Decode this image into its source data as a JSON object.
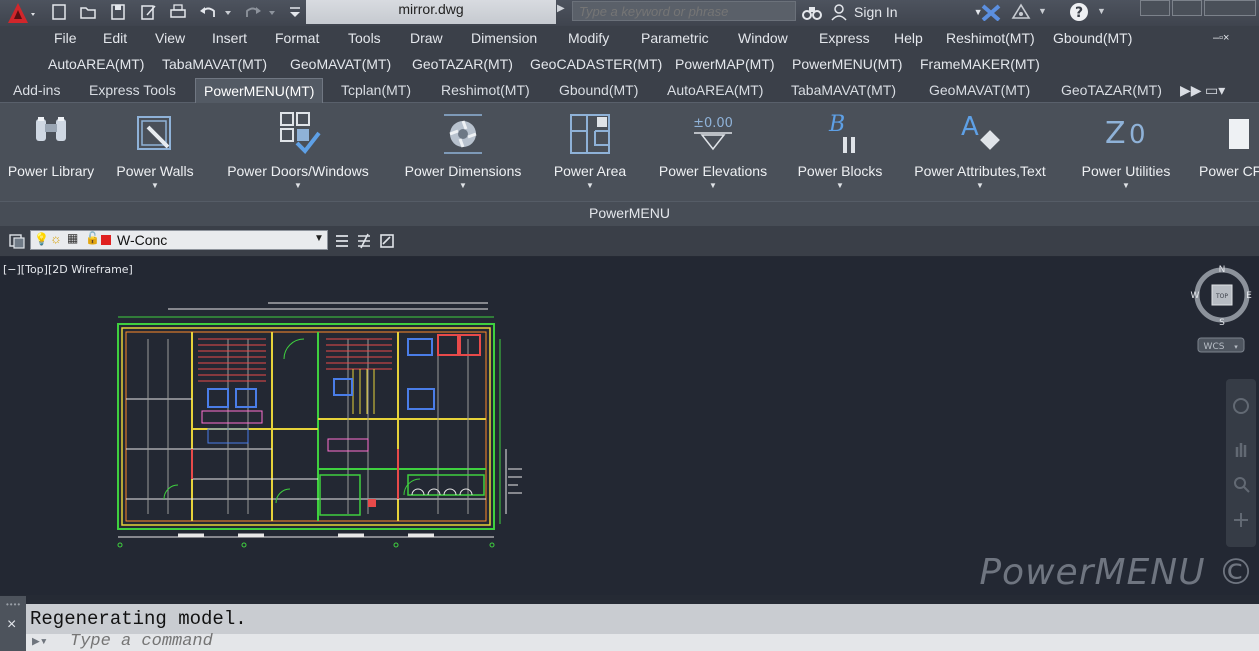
{
  "titlebar": {
    "file_name": "mirror.dwg",
    "search_placeholder": "Type a keyword or phrase",
    "sign_in": "Sign In"
  },
  "menubar1": [
    "File",
    "Edit",
    "View",
    "Insert",
    "Format",
    "Tools",
    "Draw",
    "Dimension",
    "Modify",
    "Parametric",
    "Window",
    "Express",
    "Help",
    "Reshimot(MT)",
    "Gbound(MT)"
  ],
  "menubar2": [
    "AutoAREA(MT)",
    "TabaMAVAT(MT)",
    "GeoMAVAT(MT)",
    "GeoTAZAR(MT)",
    "GeoCADASTER(MT)",
    "PowerMAP(MT)",
    "PowerMENU(MT)",
    "FrameMAKER(MT)"
  ],
  "ribbon_tabs": [
    "Add-ins",
    "Express Tools",
    "PowerMENU(MT)",
    "Tcplan(MT)",
    "Reshimot(MT)",
    "Gbound(MT)",
    "AutoAREA(MT)",
    "TabaMAVAT(MT)",
    "GeoMAVAT(MT)",
    "GeoTAZAR(MT)"
  ],
  "active_tab": "PowerMENU(MT)",
  "ribbon_tools": [
    {
      "label": "Power Library",
      "icon": "binoculars-icon"
    },
    {
      "label": "Power Walls",
      "icon": "walls-icon"
    },
    {
      "label": "Power Doors/Windows",
      "icon": "doors-windows-icon"
    },
    {
      "label": "Power Dimensions",
      "icon": "dimensions-icon"
    },
    {
      "label": "Power Area",
      "icon": "area-icon"
    },
    {
      "label": "Power Elevations",
      "icon": "elevations-icon"
    },
    {
      "label": "Power Blocks",
      "icon": "blocks-icon"
    },
    {
      "label": "Power Attributes,Text",
      "icon": "attributes-text-icon"
    },
    {
      "label": "Power Utilities",
      "icon": "utilities-icon"
    },
    {
      "label": "Power CF",
      "icon": "cf-icon"
    }
  ],
  "ribbon_panel_title": "PowerMENU",
  "elevation_glyph": "±0.00",
  "blocks_glyph": "B",
  "attr_glyph": "A",
  "util_glyph": "Z",
  "util_glyph2": "0",
  "layer": {
    "name": "W-Conc",
    "color": "#e02020"
  },
  "viewport_label": "[−][Top][2D Wireframe]",
  "viewcube": {
    "n": "N",
    "s": "S",
    "e": "E",
    "w": "W",
    "top": "TOP",
    "wcs": "WCS"
  },
  "watermark": "PowerMENU ©",
  "command": {
    "history": "Regenerating model.",
    "placeholder": "Type a command"
  },
  "colors": {
    "accent": "#d1262b",
    "ribbon_bg": "#4a5059",
    "canvas_bg": "#232833"
  }
}
